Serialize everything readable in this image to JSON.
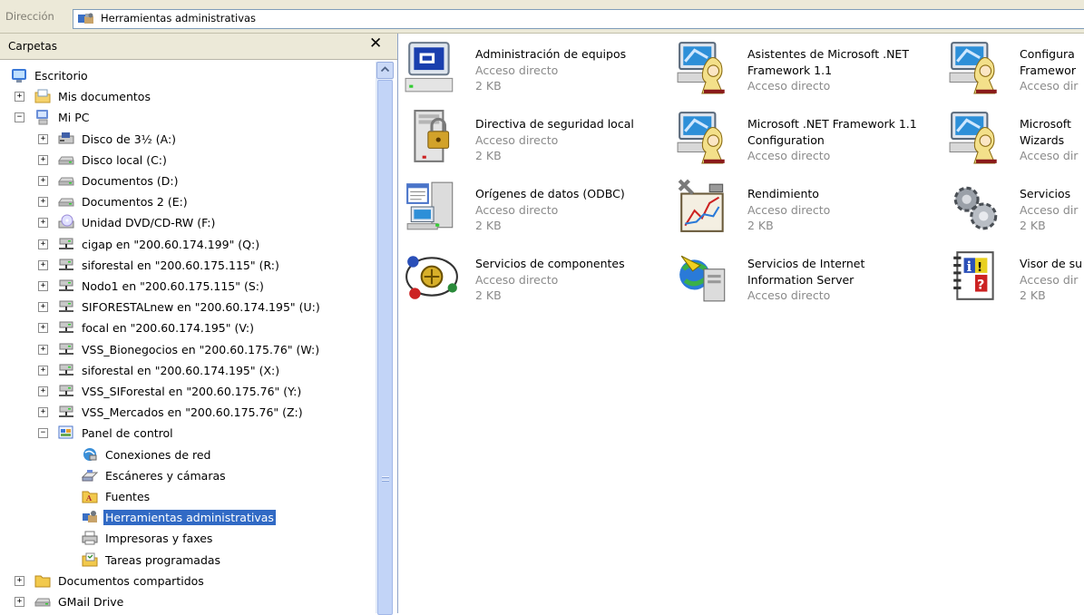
{
  "address": {
    "label": "Dirección",
    "value": "Herramientas administrativas"
  },
  "folders": {
    "title": "Carpetas",
    "close_glyph": "✕",
    "tree": [
      {
        "label": "Escritorio",
        "icon": "desktop-icon",
        "expander": ""
      },
      {
        "label": "Mis documentos",
        "icon": "my-documents-icon",
        "expander": "+"
      },
      {
        "label": "Mi PC",
        "icon": "my-computer-icon",
        "expander": "−"
      },
      {
        "label": "Disco de 3½ (A:)",
        "icon": "floppy-icon",
        "expander": "+"
      },
      {
        "label": "Disco local (C:)",
        "icon": "drive-icon",
        "expander": "+"
      },
      {
        "label": "Documentos (D:)",
        "icon": "drive-icon",
        "expander": "+"
      },
      {
        "label": "Documentos 2 (E:)",
        "icon": "drive-icon",
        "expander": "+"
      },
      {
        "label": "Unidad DVD/CD-RW (F:)",
        "icon": "dvd-icon",
        "expander": "+"
      },
      {
        "label": "cigap en \"200.60.174.199\" (Q:)",
        "icon": "network-drive-icon",
        "expander": "+"
      },
      {
        "label": "siforestal en \"200.60.175.115\" (R:)",
        "icon": "network-drive-icon",
        "expander": "+"
      },
      {
        "label": "Nodo1 en \"200.60.175.115\" (S:)",
        "icon": "network-drive-icon",
        "expander": "+"
      },
      {
        "label": "SIFORESTALnew en \"200.60.174.195\" (U:)",
        "icon": "network-drive-icon",
        "expander": "+"
      },
      {
        "label": "focal en \"200.60.174.195\" (V:)",
        "icon": "network-drive-icon",
        "expander": "+"
      },
      {
        "label": "VSS_Bionegocios en \"200.60.175.76\" (W:)",
        "icon": "network-drive-icon",
        "expander": "+"
      },
      {
        "label": "siforestal en \"200.60.174.195\" (X:)",
        "icon": "network-drive-icon",
        "expander": "+"
      },
      {
        "label": "VSS_SIForestal en \"200.60.175.76\" (Y:)",
        "icon": "network-drive-icon",
        "expander": "+"
      },
      {
        "label": "VSS_Mercados en \"200.60.175.76\" (Z:)",
        "icon": "network-drive-icon",
        "expander": "+"
      },
      {
        "label": "Panel de control",
        "icon": "control-panel-icon",
        "expander": "−"
      },
      {
        "label": "Conexiones de red",
        "icon": "network-connections-icon",
        "expander": ""
      },
      {
        "label": "Escáneres y cámaras",
        "icon": "scanner-icon",
        "expander": ""
      },
      {
        "label": "Fuentes",
        "icon": "fonts-folder-icon",
        "expander": ""
      },
      {
        "label": "Herramientas administrativas",
        "icon": "admin-tools-icon",
        "expander": "",
        "selected": true
      },
      {
        "label": "Impresoras y faxes",
        "icon": "printer-icon",
        "expander": ""
      },
      {
        "label": "Tareas programadas",
        "icon": "scheduled-tasks-icon",
        "expander": ""
      },
      {
        "label": "Documentos compartidos",
        "icon": "folder-icon",
        "expander": "+"
      },
      {
        "label": "GMail Drive",
        "icon": "drive-icon",
        "expander": "+"
      }
    ]
  },
  "items": [
    {
      "name": "Administración de equipos",
      "lines": [
        "Administración de equipos"
      ],
      "type": "Acceso directo",
      "size": "2 KB",
      "icon": "computer-management-icon"
    },
    {
      "name": "Asistentes de Microsoft .NET Framework 1.1",
      "lines": [
        "Asistentes de Microsoft .NET",
        "Framework 1.1"
      ],
      "type": "Acceso directo",
      "size": "",
      "icon": "dotnet-wizard-icon"
    },
    {
      "name": "Configura Framewor",
      "lines": [
        "Configura",
        "Framewor"
      ],
      "type": "Acceso dir",
      "size": "",
      "icon": "dotnet-wizard-icon"
    },
    {
      "name": "Directiva de seguridad local",
      "lines": [
        "Directiva de seguridad local"
      ],
      "type": "Acceso directo",
      "size": "2 KB",
      "icon": "security-policy-icon"
    },
    {
      "name": "Microsoft .NET Framework 1.1 Configuration",
      "lines": [
        "Microsoft .NET Framework 1.1",
        "Configuration"
      ],
      "type": "Acceso directo",
      "size": "",
      "icon": "dotnet-wizard-icon"
    },
    {
      "name": "Microsoft Wizards",
      "lines": [
        "Microsoft",
        "Wizards"
      ],
      "type": "Acceso dir",
      "size": "",
      "icon": "dotnet-wizard-icon"
    },
    {
      "name": "Orígenes de datos (ODBC)",
      "lines": [
        "Orígenes de datos (ODBC)"
      ],
      "type": "Acceso directo",
      "size": "2 KB",
      "icon": "odbc-icon"
    },
    {
      "name": "Rendimiento",
      "lines": [
        "Rendimiento"
      ],
      "type": "Acceso directo",
      "size": "2 KB",
      "icon": "performance-icon"
    },
    {
      "name": "Servicios",
      "lines": [
        "Servicios"
      ],
      "type": "Acceso dir",
      "size": "2 KB",
      "icon": "services-icon"
    },
    {
      "name": "Servicios de componentes",
      "lines": [
        "Servicios de componentes"
      ],
      "type": "Acceso directo",
      "size": "2 KB",
      "icon": "component-services-icon"
    },
    {
      "name": "Servicios de Internet Information Server",
      "lines": [
        "Servicios de Internet",
        "Information Server"
      ],
      "type": "Acceso directo",
      "size": "",
      "icon": "iis-icon"
    },
    {
      "name": "Visor de su",
      "lines": [
        "Visor de su"
      ],
      "type": "Acceso dir",
      "size": "2 KB",
      "icon": "event-viewer-icon"
    }
  ]
}
